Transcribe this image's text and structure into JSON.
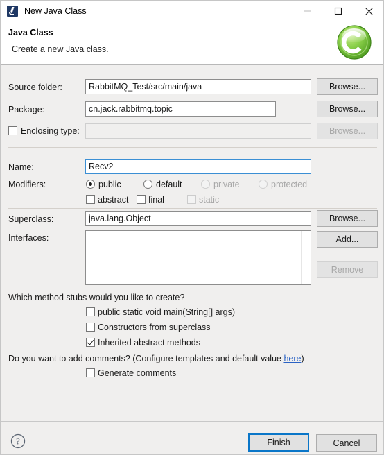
{
  "window": {
    "title": "New Java Class",
    "icon": "java-class-icon",
    "controls": {
      "minimize": "minimize-icon",
      "maximize": "maximize-icon",
      "close": "close-icon"
    }
  },
  "header": {
    "title": "Java Class",
    "subtitle": "Create a new Java class.",
    "logo": "green-c-wizard-icon",
    "logo_letter": "C",
    "logo_color": "#6cc030"
  },
  "form": {
    "source_folder": {
      "label": "Source folder:",
      "value": "RabbitMQ_Test/src/main/java",
      "button": "Browse..."
    },
    "package": {
      "label": "Package:",
      "value": "cn.jack.rabbitmq.topic",
      "button": "Browse..."
    },
    "enclosing_type": {
      "label": "Enclosing type:",
      "value": "",
      "checked": false,
      "enabled": false,
      "button": "Browse..."
    },
    "name": {
      "label": "Name:",
      "value": "Recv2"
    },
    "modifiers": {
      "label": "Modifiers:",
      "access": [
        {
          "label": "public",
          "selected": true,
          "enabled": true
        },
        {
          "label": "default",
          "selected": false,
          "enabled": true
        },
        {
          "label": "private",
          "selected": false,
          "enabled": false
        },
        {
          "label": "protected",
          "selected": false,
          "enabled": false
        }
      ],
      "flags": [
        {
          "label": "abstract",
          "checked": false,
          "enabled": true
        },
        {
          "label": "final",
          "checked": false,
          "enabled": true
        },
        {
          "label": "static",
          "checked": false,
          "enabled": false
        }
      ]
    },
    "superclass": {
      "label": "Superclass:",
      "value": "java.lang.Object",
      "button": "Browse..."
    },
    "interfaces": {
      "label": "Interfaces:",
      "items": [],
      "add_button": "Add...",
      "remove_button": "Remove"
    }
  },
  "stubs": {
    "question": "Which method stubs would you like to create?",
    "options": [
      {
        "label": "public static void main(String[] args)",
        "checked": false
      },
      {
        "label": "Constructors from superclass",
        "checked": false
      },
      {
        "label": "Inherited abstract methods",
        "checked": true
      }
    ]
  },
  "comments": {
    "question_prefix": "Do you want to add comments? (Configure templates and default value ",
    "link": "here",
    "question_suffix": ")",
    "option": {
      "label": "Generate comments",
      "checked": false
    }
  },
  "footer": {
    "help": "help-icon",
    "finish": "Finish",
    "cancel": "Cancel"
  }
}
